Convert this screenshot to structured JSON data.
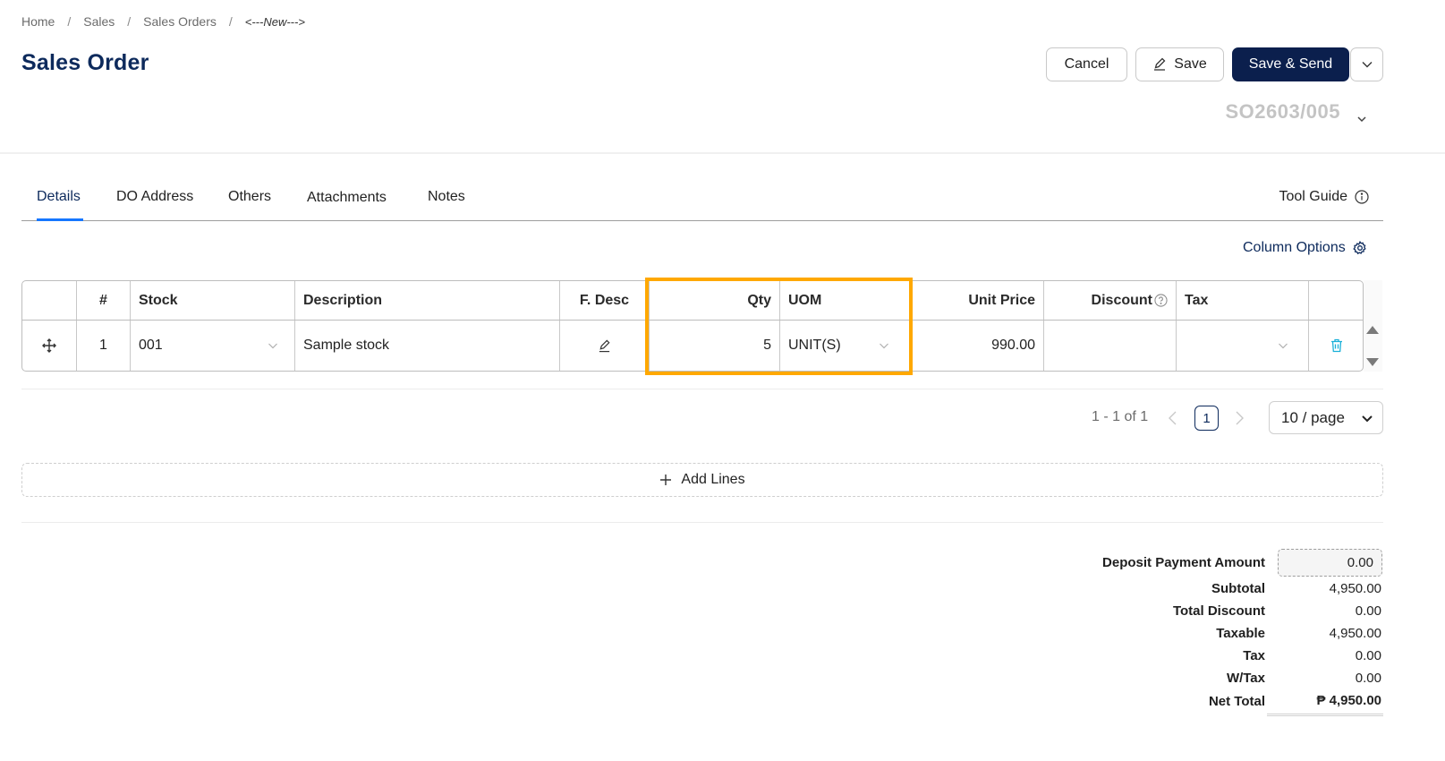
{
  "breadcrumb": {
    "items": [
      "Home",
      "Sales",
      "Sales Orders"
    ],
    "separator": "/",
    "current": "<---New--->"
  },
  "page_title": "Sales Order",
  "header_actions": {
    "cancel": "Cancel",
    "save": "Save",
    "save_send": "Save & Send"
  },
  "document_number": "SO2603/005",
  "tabs": [
    "Details",
    "DO Address",
    "Others",
    "Attachments",
    "Notes"
  ],
  "active_tab": "Details",
  "tool_guide": "Tool Guide",
  "column_options": "Column Options",
  "table": {
    "columns": [
      "",
      "#",
      "Stock",
      "Description",
      "F. Desc",
      "Qty",
      "UOM",
      "Unit Price",
      "Discount",
      "Tax",
      ""
    ],
    "rows": [
      {
        "no": "1",
        "stock": "001",
        "description": "Sample stock",
        "qty": "5",
        "uom": "UNIT(S)",
        "unit_price": "990.00",
        "discount": "",
        "tax": ""
      }
    ]
  },
  "pagination": {
    "range": "1 - 1 of 1",
    "current_page": "1",
    "page_size": "10 / page"
  },
  "add_lines": "Add Lines",
  "totals": {
    "deposit_label": "Deposit Payment Amount",
    "deposit_value": "0.00",
    "subtotal_label": "Subtotal",
    "subtotal_value": "4,950.00",
    "total_discount_label": "Total Discount",
    "total_discount_value": "0.00",
    "taxable_label": "Taxable",
    "taxable_value": "4,950.00",
    "tax_label": "Tax",
    "tax_value": "0.00",
    "wtax_label": "W/Tax",
    "wtax_value": "0.00",
    "net_total_label": "Net Total",
    "net_total_value": "₱ 4,950.00"
  },
  "colors": {
    "primary": "#0b1f4d",
    "title": "#0d2a5c",
    "tab_active_underline": "#1677ff",
    "highlight": "#ffa800",
    "delete_icon": "#1ab0d8"
  },
  "icons": [
    "move-icon",
    "edit-pencil-icon",
    "delete-icon",
    "info-icon",
    "gear-icon",
    "chevron-down-icon",
    "plus-icon",
    "help-icon"
  ]
}
